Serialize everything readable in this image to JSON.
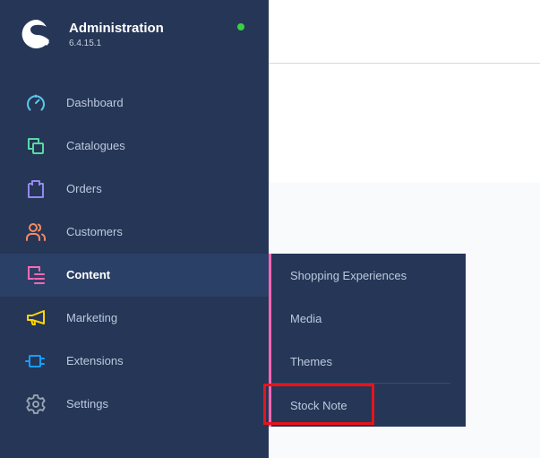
{
  "brand": {
    "title": "Administration",
    "version": "6.4.15.1",
    "status_color": "#37d046"
  },
  "nav": {
    "items": [
      {
        "label": "Dashboard",
        "icon": "gauge-icon",
        "color": "#57c8ed"
      },
      {
        "label": "Catalogues",
        "icon": "copy-icon",
        "color": "#57d9a3"
      },
      {
        "label": "Orders",
        "icon": "shopping-bag-icon",
        "color": "#9388ef"
      },
      {
        "label": "Customers",
        "icon": "users-icon",
        "color": "#f88962"
      },
      {
        "label": "Content",
        "icon": "content-icon",
        "color": "#ff68b4",
        "active": true
      },
      {
        "label": "Marketing",
        "icon": "megaphone-icon",
        "color": "#ffd700"
      },
      {
        "label": "Extensions",
        "icon": "plug-icon",
        "color": "#189eff"
      },
      {
        "label": "Settings",
        "icon": "gear-icon",
        "color": "#9aa8b5"
      }
    ]
  },
  "flyout": {
    "items": [
      {
        "label": "Shopping Experiences"
      },
      {
        "label": "Media"
      },
      {
        "label": "Themes"
      },
      {
        "label": "Stock Note",
        "highlighted": true
      }
    ],
    "accent_color": "#ff68b4"
  }
}
